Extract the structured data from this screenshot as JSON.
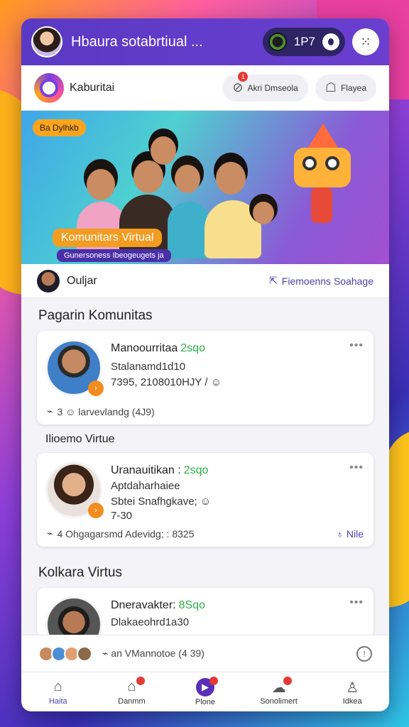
{
  "topbar": {
    "title": "Hbaura sotabrtiual ...",
    "coin_value": "1P7"
  },
  "appbar": {
    "app_name": "Kaburitai",
    "btn1_label": "Akri Dmseola",
    "btn1_badge": "1",
    "btn2_label": "Flayea"
  },
  "banner": {
    "tag": "Ba Dylhkb",
    "title": "Komunitars Virtual",
    "subtitle": "Gunersoness Ibeogeugets ja"
  },
  "user": {
    "name": "Ouljar",
    "action": "Fiemoenns Soahage"
  },
  "sections": {
    "s1_title": "Pagarin Komunitas",
    "sub1": "Ilioemo Virtue",
    "s2_title": "Kolkara Virtus"
  },
  "cards": [
    {
      "name": "Manoourritaa",
      "highlight": "2sqo",
      "line1": "Stalanamd1d10",
      "line2": "7395, 2108010HJY  / ☺",
      "foot": "3  ☺  larvevlandg (4J9)",
      "more": ""
    },
    {
      "name": "Uranauitikan :",
      "highlight": "2sqo",
      "line1": "Aptdaharhaiee",
      "line2": "Sbtei Snafhgkave; ☺",
      "line3": "7-30",
      "foot": "4  Ohgagarsmd Adevidg; : 8325",
      "more": "Nile"
    },
    {
      "name": "Dneravakter:",
      "highlight": "8Sqo",
      "line1": "Dlakaeohrd1a30"
    }
  ],
  "bottom_strip": {
    "text": "an VMannotoe (4 39)"
  },
  "nav": {
    "items": [
      {
        "label": "Haita",
        "icon": "home-icon"
      },
      {
        "label": "Danmm",
        "icon": "house-icon"
      },
      {
        "label": "Plone",
        "icon": "play-icon"
      },
      {
        "label": "Sonolimert",
        "icon": "chat-icon"
      },
      {
        "label": "Idkea",
        "icon": "profile-icon"
      }
    ]
  },
  "colors": {
    "primary": "#5a39c4",
    "accent": "#f28c1e",
    "green": "#2bb04a"
  }
}
